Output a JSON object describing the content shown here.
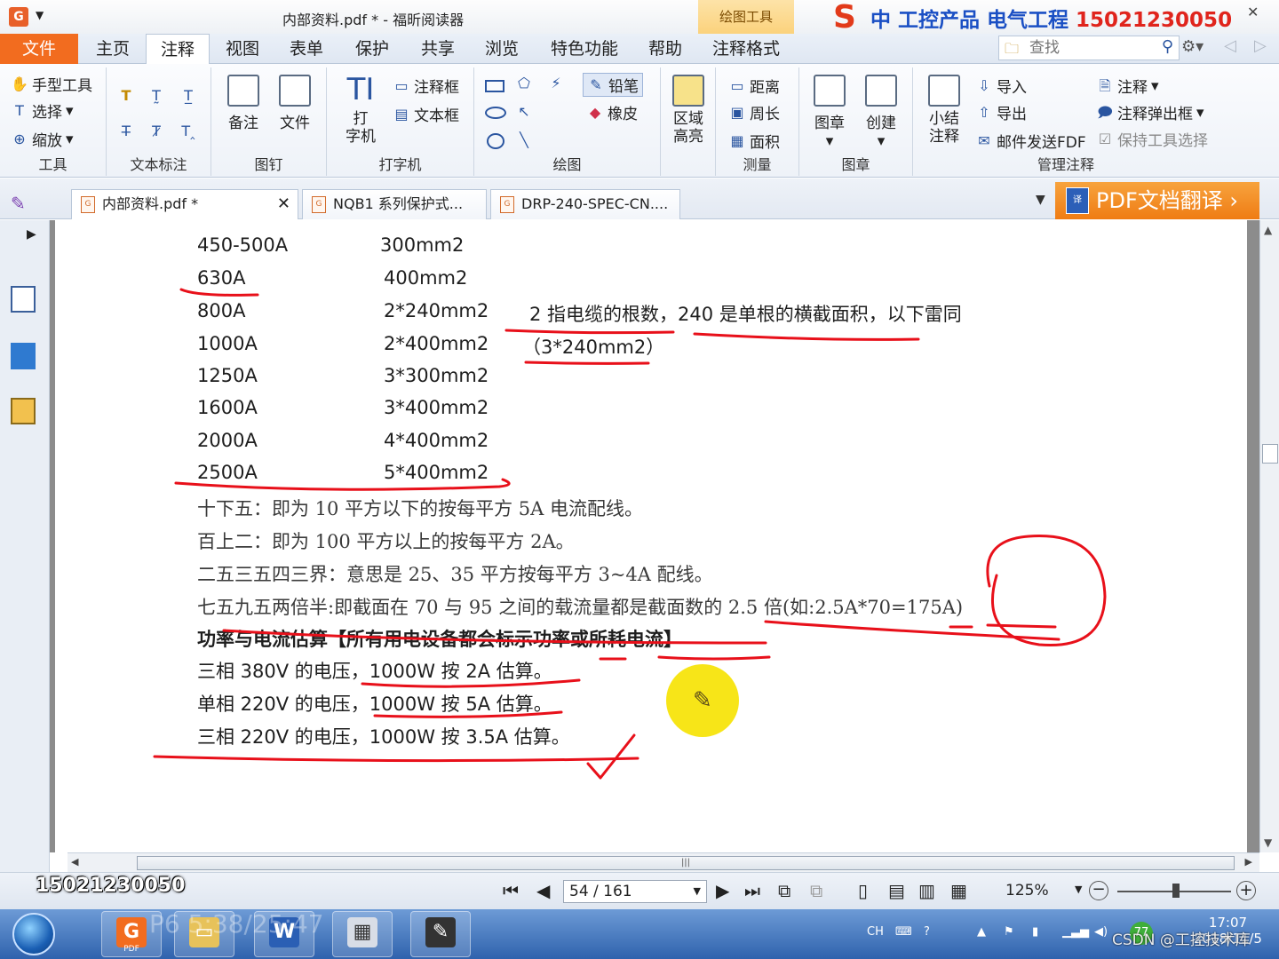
{
  "window": {
    "app_icon": "G",
    "title": "内部资料.pdf * - 福昕阅读器",
    "context_tab": "绘图工具",
    "ad": {
      "logo": "S",
      "text": "中 工控产品 电气工程",
      "phone": "15021230050"
    }
  },
  "menu": {
    "tabs": [
      "文件",
      "主页",
      "注释",
      "视图",
      "表单",
      "保护",
      "共享",
      "浏览",
      "特色功能",
      "帮助",
      "注释格式"
    ],
    "active": "注释",
    "search_placeholder": "查找"
  },
  "ribbon": {
    "tools": {
      "items": [
        "手型工具",
        "选择",
        "缩放"
      ],
      "label": "工具"
    },
    "text_markup": {
      "label": "文本标注"
    },
    "pin": {
      "items": [
        "备注",
        "文件"
      ],
      "label": "图钉"
    },
    "typewriter": {
      "big": "打\n字机",
      "items": [
        "注释框",
        "文本框"
      ],
      "label": "打字机"
    },
    "drawing": {
      "items": [
        "铅笔",
        "橡皮"
      ],
      "label": "绘图"
    },
    "area": {
      "big": "区域\n高亮"
    },
    "measure": {
      "items": [
        "距离",
        "周长",
        "面积"
      ],
      "label": "测量"
    },
    "stamp": {
      "items": [
        "图章",
        "创建"
      ],
      "label": "图章"
    },
    "manage": {
      "big": "小结\n注释",
      "items": [
        "导入",
        "导出",
        "邮件发送FDF",
        "注释",
        "注释弹出框",
        "保持工具选择"
      ],
      "label": "管理注释"
    }
  },
  "doc_tabs": [
    {
      "label": "内部资料.pdf *",
      "active": true
    },
    {
      "label": "NQB1 系列保护式...",
      "active": false
    },
    {
      "label": "DRP-240-SPEC-CN....",
      "active": false
    }
  ],
  "translate_button": "PDF文档翻译",
  "document": {
    "table_rows": [
      {
        "current": "450-500A",
        "section": "300mm2"
      },
      {
        "current": "630A",
        "section": "400mm2"
      },
      {
        "current": "800A",
        "section": "2*240mm2"
      },
      {
        "current": "1000A",
        "section": "2*400mm2"
      },
      {
        "current": "1250A",
        "section": "3*300mm2"
      },
      {
        "current": "1600A",
        "section": "3*400mm2"
      },
      {
        "current": "2000A",
        "section": "4*400mm2"
      },
      {
        "current": "2500A",
        "section": "5*400mm2"
      }
    ],
    "note_line1": "2 指电缆的根数，240 是单根的横截面积，以下雷同",
    "note_line2": "（3*240mm2）",
    "rules": [
      "十下五：即为 10 平方以下的按每平方 5A 电流配线。",
      "百上二：即为 100 平方以上的按每平方 2A。",
      "二五三五四三界：意思是 25、35 平方按每平方 3~4A 配线。",
      "七五九五两倍半:即截面在 70 与 95 之间的载流量都是截面数的 2.5 倍(如:2.5A*70=175A)"
    ],
    "heading": "功率与电流估算【所有用电设备都会标示功率或所耗电流】",
    "estimates": [
      "三相 380V 的电压，1000W 按 2A 估算。",
      "单相 220V 的电压，1000W 按 5A 估算。",
      "三相 220V 的电压，1000W 按 3.5A 估算。"
    ]
  },
  "statusbar": {
    "watermark_phone": "15021230050",
    "page": "54 / 161",
    "zoom": "125%"
  },
  "taskbar": {
    "pdf_label": "PDF",
    "tray_lang": "CH",
    "clock_time": "17:07",
    "clock_date": "2018/11/5",
    "csdn": "CSDN @工控技术库",
    "time_watermark": "P6 5:38/25:47",
    "badge": "77"
  },
  "colors": {
    "accent": "#f26c1f",
    "ink_red": "#e8101a",
    "ribbon_blue": "#2a55a0"
  }
}
